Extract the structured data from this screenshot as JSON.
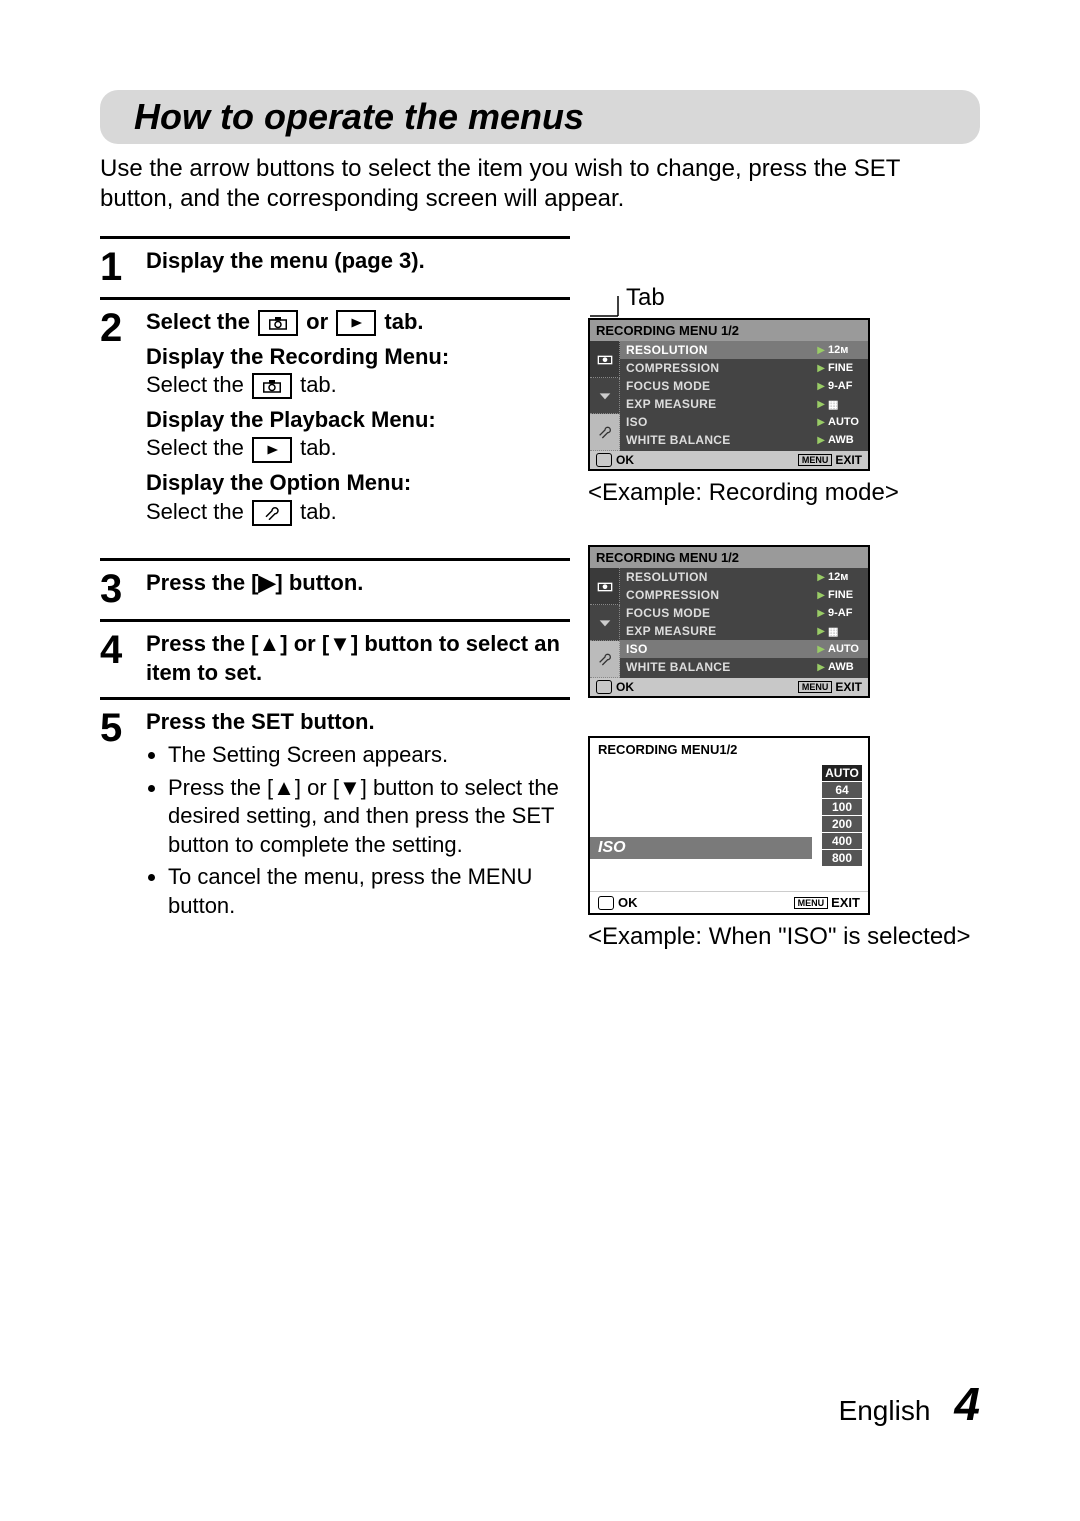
{
  "title": "How to operate the menus",
  "intro": "Use the arrow buttons to select the item you wish to change, press the SET button, and the corresponding screen will appear.",
  "steps": {
    "s1": {
      "num": "1",
      "lead": "Display the menu (page 3)."
    },
    "s2": {
      "num": "2",
      "lead_a": "Select the ",
      "lead_b": " or ",
      "lead_c": " tab.",
      "rec_hd": "Display the Recording Menu:",
      "rec_tx_a": "Select the ",
      "rec_tx_b": " tab.",
      "pb_hd": "Display the Playback Menu:",
      "pb_tx_a": "Select the ",
      "pb_tx_b": " tab.",
      "opt_hd": "Display the Option Menu:",
      "opt_tx_a": "Select the ",
      "opt_tx_b": " tab."
    },
    "s3": {
      "num": "3",
      "lead": "Press the [▶] button."
    },
    "s4": {
      "num": "4",
      "lead": "Press the [▲] or [▼] button to select an item to set."
    },
    "s5": {
      "num": "5",
      "lead": "Press the SET button.",
      "b1": "The Setting Screen appears.",
      "b2": "Press the [▲] or [▼] button to select the desired setting, and then press the SET button to complete the setting.",
      "b3": "To cancel the menu, press the MENU button."
    }
  },
  "right": {
    "tab_label": "Tab",
    "example_rec": "<Example: Recording mode>",
    "example_iso": "<Example: When \"ISO\" is selected>"
  },
  "lcd_menu": {
    "title": "RECORDING MENU 1/2",
    "rows": [
      {
        "name": "RESOLUTION",
        "val": "12ᴍ"
      },
      {
        "name": "COMPRESSION",
        "val": "FINE"
      },
      {
        "name": "FOCUS MODE",
        "val": "9-AF"
      },
      {
        "name": "EXP MEASURE",
        "val": "▦"
      },
      {
        "name": "ISO",
        "val": "AUTO"
      },
      {
        "name": "WHITE BALANCE",
        "val": "AWB"
      }
    ],
    "ok": "OK",
    "menu": "MENU",
    "exit": "EXIT"
  },
  "lcd_iso": {
    "title": "RECORDING MENU1/2",
    "label": "ISO",
    "values": [
      "AUTO",
      "64",
      "100",
      "200",
      "400",
      "800"
    ],
    "ok": "OK",
    "menu": "MENU",
    "exit": "EXIT"
  },
  "footer": {
    "lang": "English",
    "page": "4"
  }
}
